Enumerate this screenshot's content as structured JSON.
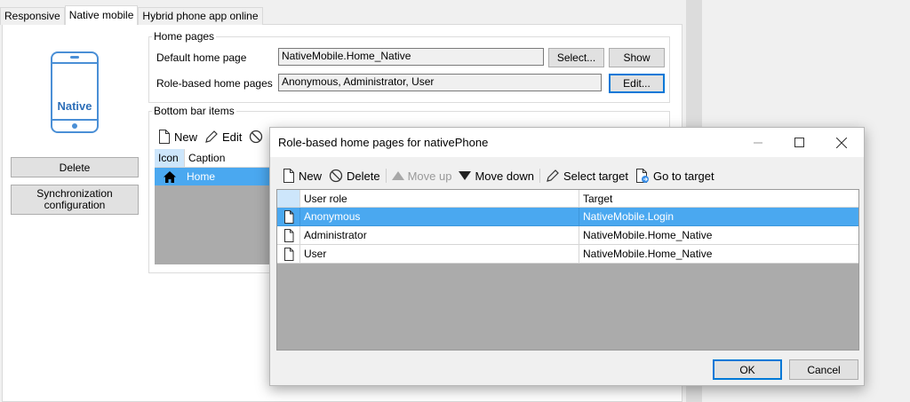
{
  "tabs": [
    {
      "label": "Responsive"
    },
    {
      "label": "Native mobile"
    },
    {
      "label": "Hybrid phone app online"
    }
  ],
  "left_panel": {
    "phone_label": "Native",
    "delete_label": "Delete",
    "sync_label_line1": "Synchronization",
    "sync_label_line2": "configuration"
  },
  "home_pages": {
    "group_title": "Home pages",
    "default_label": "Default home page",
    "default_value": "NativeMobile.Home_Native",
    "select_label": "Select...",
    "show_label": "Show",
    "role_label": "Role-based home pages",
    "role_value": "Anonymous, Administrator, User",
    "edit_label": "Edit..."
  },
  "bottom_bar": {
    "group_title": "Bottom bar items",
    "toolbar": {
      "new": "New",
      "edit": "Edit"
    },
    "columns": [
      "Icon",
      "Caption"
    ],
    "rows": [
      {
        "caption": "Home"
      }
    ]
  },
  "dialog": {
    "title": "Role-based home pages for nativePhone",
    "toolbar": {
      "new": "New",
      "delete": "Delete",
      "move_up": "Move up",
      "move_down": "Move down",
      "select_target": "Select target",
      "go_to_target": "Go to target"
    },
    "columns": [
      "User role",
      "Target"
    ],
    "rows": [
      {
        "role": "Anonymous",
        "target": "NativeMobile.Login",
        "selected": true
      },
      {
        "role": "Administrator",
        "target": "NativeMobile.Home_Native",
        "selected": false
      },
      {
        "role": "User",
        "target": "NativeMobile.Home_Native",
        "selected": false
      }
    ],
    "ok_label": "OK",
    "cancel_label": "Cancel"
  },
  "colors": {
    "selection": "#4aa8f0",
    "accent": "#0078d7",
    "grid_empty": "#ababab"
  }
}
